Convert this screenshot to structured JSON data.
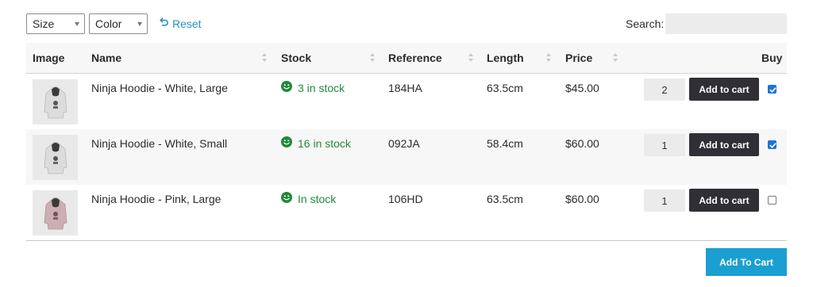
{
  "filters": {
    "size_select": "Size",
    "color_select": "Color",
    "reset_label": "Reset"
  },
  "search": {
    "label": "Search:",
    "value": ""
  },
  "table": {
    "columns": [
      "Image",
      "Name",
      "Stock",
      "Reference",
      "Length",
      "Price",
      "Buy"
    ],
    "rows": [
      {
        "name": "Ninja Hoodie - White, Large",
        "stock": "3 in stock",
        "reference": "184HA",
        "length": "63.5cm",
        "price": "$45.00",
        "qty": "2",
        "button": "Add to cart",
        "checked": true,
        "image": "white-hoodie-image"
      },
      {
        "name": "Ninja Hoodie - White, Small",
        "stock": "16 in stock",
        "reference": "092JA",
        "length": "58.4cm",
        "price": "$60.00",
        "qty": "1",
        "button": "Add to cart",
        "checked": true,
        "image": "white-hoodie-image"
      },
      {
        "name": "Ninja Hoodie - Pink, Large",
        "stock": "In stock",
        "reference": "106HD",
        "length": "63.5cm",
        "price": "$60.00",
        "qty": "1",
        "button": "Add to cart",
        "checked": false,
        "image": "pink-hoodie-image"
      }
    ]
  },
  "footer": {
    "add_all_label": "Add To Cart"
  },
  "colors": {
    "link": "#2a8fbd",
    "in_stock": "#23883b",
    "cart_button": "#2f2f35",
    "add_all_button": "#1a9fd1",
    "checkbox": "#1f73d4"
  },
  "icons": {
    "reset": "undo-arrow-icon",
    "stock": "smiley-icon",
    "sort": "sort-arrows-icon",
    "checked": "checkmark-icon"
  }
}
